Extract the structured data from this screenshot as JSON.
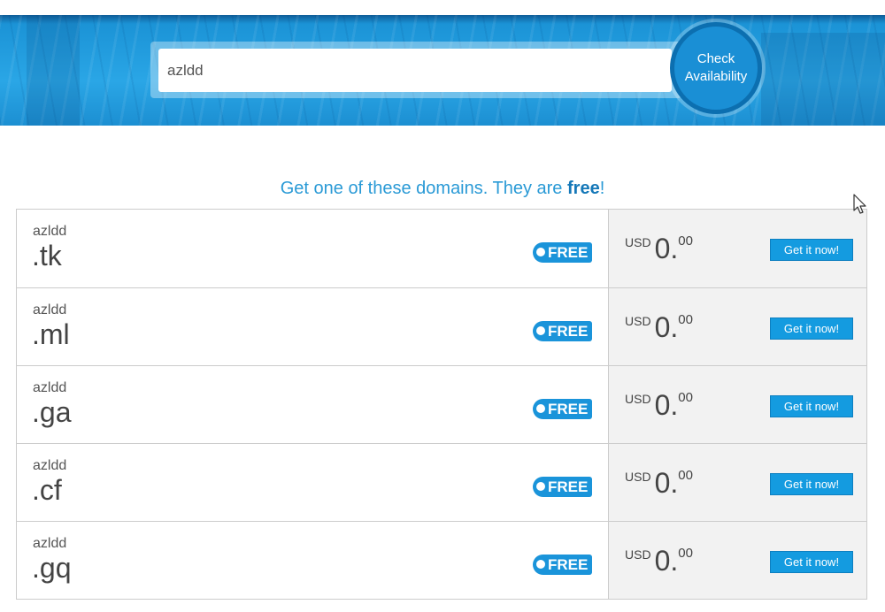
{
  "search": {
    "value": "azldd",
    "button_line1": "Check",
    "button_line2": "Availability"
  },
  "heading": {
    "prefix": "Get one of these domains. They are ",
    "free_word": "free",
    "suffix": "!"
  },
  "results": [
    {
      "name": "azldd",
      "tld": ".tk",
      "badge": "FREE",
      "currency": "USD",
      "price_int": "0.",
      "price_cents": "00",
      "button": "Get it now!"
    },
    {
      "name": "azldd",
      "tld": ".ml",
      "badge": "FREE",
      "currency": "USD",
      "price_int": "0.",
      "price_cents": "00",
      "button": "Get it now!"
    },
    {
      "name": "azldd",
      "tld": ".ga",
      "badge": "FREE",
      "currency": "USD",
      "price_int": "0.",
      "price_cents": "00",
      "button": "Get it now!"
    },
    {
      "name": "azldd",
      "tld": ".cf",
      "badge": "FREE",
      "currency": "USD",
      "price_int": "0.",
      "price_cents": "00",
      "button": "Get it now!"
    },
    {
      "name": "azldd",
      "tld": ".gq",
      "badge": "FREE",
      "currency": "USD",
      "price_int": "0.",
      "price_cents": "00",
      "button": "Get it now!"
    }
  ],
  "colors": {
    "accent": "#1a94da",
    "heading": "#2a9ad6",
    "price_bg": "#f2f2f2"
  }
}
